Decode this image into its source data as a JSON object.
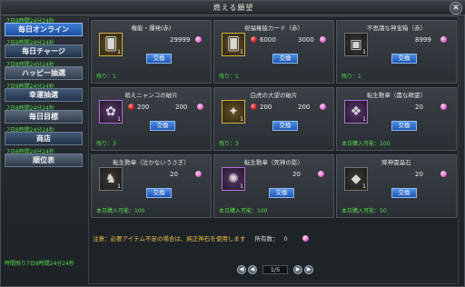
{
  "window": {
    "title": "燃える願望",
    "close_glyph": "✕"
  },
  "sidebar": {
    "items": [
      {
        "caption": "7日8時間24分24秒",
        "label": "毎日オンライン",
        "state": "active"
      },
      {
        "caption": "7日8時間24分24秒",
        "label": "毎日チャージ",
        "state": "mid"
      },
      {
        "caption": "7日8時間24分24秒",
        "label": "ハッピー抽選",
        "state": "normal"
      },
      {
        "caption": "7日8時間24分24秒",
        "label": "幸運抽選",
        "state": "mid"
      },
      {
        "caption": "7日8時間24分24秒",
        "label": "毎日目標",
        "state": "normal"
      },
      {
        "caption": "7日8時間24分24秒",
        "label": "商店",
        "state": "mid"
      },
      {
        "caption": "7日8時間24分24秒",
        "label": "順位表",
        "state": "normal"
      }
    ],
    "footer": "時間残り7日8時間24分24秒"
  },
  "cards": [
    {
      "title": "権能・爆発(赤)",
      "icon": "card-icon",
      "glyph": "🂠",
      "slot": "gold",
      "count": "1",
      "cost": "29999",
      "cost_gem": "pink",
      "extra_cost": "",
      "button": "交換",
      "remaining_label": "残り：",
      "remaining": "1"
    },
    {
      "title": "祝福権能カード（赤）",
      "icon": "card-icon",
      "glyph": "🂠",
      "slot": "gold",
      "count": "1",
      "cost": "6000",
      "cost_gem": "red",
      "extra_cost": "3000",
      "button": "交換",
      "remaining_label": "残り：",
      "remaining": "1"
    },
    {
      "title": "不思議な神宝箱（赤）",
      "icon": "chest-icon",
      "glyph": "▣",
      "slot": "plain",
      "count": "1",
      "cost": "8999",
      "cost_gem": "pink",
      "extra_cost": "",
      "button": "交換",
      "remaining_label": "残り：",
      "remaining": "1"
    },
    {
      "title": "萌えニャンコの破片",
      "icon": "cat-shard-icon",
      "glyph": "✿",
      "slot": "purple",
      "count": "1",
      "cost": "200",
      "cost_gem": "red",
      "extra_cost": "200",
      "button": "交換",
      "remaining_label": "残り：",
      "remaining": "3"
    },
    {
      "title": "白虎の大望の破片",
      "icon": "shard-icon",
      "glyph": "✦",
      "slot": "gold",
      "count": "1",
      "cost": "200",
      "cost_gem": "red",
      "extra_cost": "200",
      "button": "交換",
      "remaining_label": "残り：",
      "remaining": "3"
    },
    {
      "title": "転生勲章（農な精霊）",
      "icon": "medal-icon",
      "glyph": "❖",
      "slot": "purple",
      "count": "1",
      "cost": "20",
      "cost_gem": "pink",
      "extra_cost": "",
      "button": "交換",
      "remaining_label": "本日購入可能：",
      "remaining": "100"
    },
    {
      "title": "転生勲章（泣かないうさぎ）",
      "icon": "rabbit-medal-icon",
      "glyph": "♞",
      "slot": "plain",
      "count": "1",
      "cost": "20",
      "cost_gem": "pink",
      "extra_cost": "",
      "button": "交換",
      "remaining_label": "本日購入可能：",
      "remaining": "100"
    },
    {
      "title": "転生勲章（死神の影）",
      "icon": "reaper-medal-icon",
      "glyph": "✺",
      "slot": "purple",
      "count": "1",
      "cost": "20",
      "cost_gem": "pink",
      "extra_cost": "",
      "button": "交換",
      "remaining_label": "本日購入可能：",
      "remaining": "100"
    },
    {
      "title": "降神霊晶石",
      "icon": "spirit-crystal-icon",
      "glyph": "◆",
      "slot": "plain",
      "count": "1",
      "cost": "20",
      "cost_gem": "pink",
      "extra_cost": "",
      "button": "交換",
      "remaining_label": "本日購入可能：",
      "remaining": "50"
    }
  ],
  "notice": {
    "text": "注意：必要アイテム不足の場合は、純正神石を使用します",
    "holding_label": "所有数：",
    "holding_value": "0"
  },
  "pager": {
    "first": "◀",
    "prev": "◀",
    "page": "1/5",
    "next": "▶",
    "last": "▶"
  }
}
